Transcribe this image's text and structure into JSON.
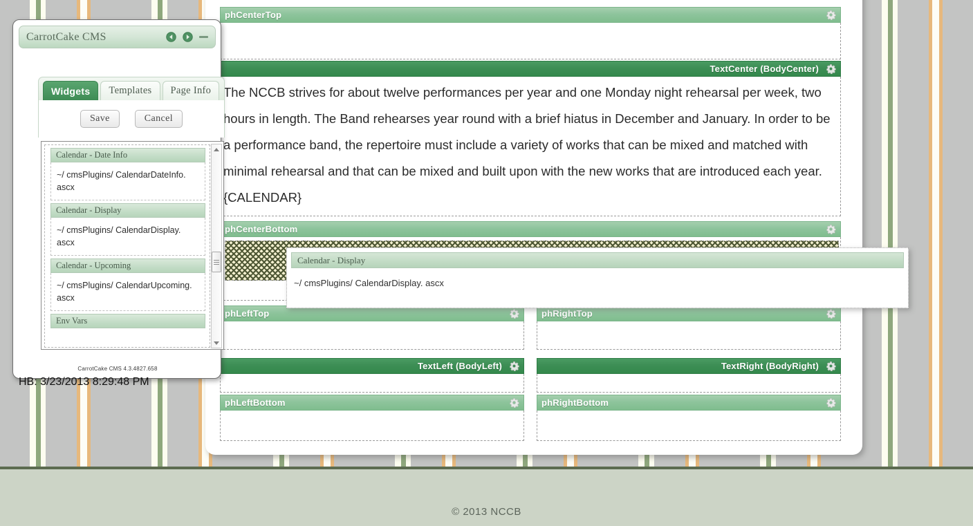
{
  "wallpaper": {
    "stripe_colors": [
      "#c3c4c3",
      "#fdfdf0",
      "#8fa87d",
      "#e7b87c"
    ],
    "baseline_color": "#5c6b50"
  },
  "footer": {
    "copyright": "© 2013 NCCB",
    "band_color": "#ccd4c6"
  },
  "cms_window": {
    "title": "CarrotCake CMS",
    "controls": {
      "prev_label": "◀",
      "next_label": "▶",
      "minimize_label": "—"
    },
    "tabs": [
      {
        "label": "Widgets",
        "active": true
      },
      {
        "label": "Templates",
        "active": false
      },
      {
        "label": "Page Info",
        "active": false
      }
    ],
    "buttons": {
      "save_label": "Save",
      "cancel_label": "Cancel"
    },
    "widgets": [
      {
        "name": "Calendar - Date Info",
        "path": "~/ cmsPlugins/ CalendarDateInfo. ascx"
      },
      {
        "name": "Calendar - Display",
        "path": "~/ cmsPlugins/ CalendarDisplay. ascx"
      },
      {
        "name": "Calendar - Upcoming",
        "path": "~/ cmsPlugins/ CalendarUpcoming. ascx"
      },
      {
        "name": "Env Vars",
        "path": ""
      }
    ],
    "version": "CarrotCake CMS 4.3.4827.658",
    "heartbeat": "HB: 3/23/2013 8:29:48 PM"
  },
  "drag_widget": {
    "name": "Calendar - Display",
    "path": "~/ cmsPlugins/ CalendarDisplay. ascx"
  },
  "page": {
    "zones": [
      {
        "id": "phCenterTop",
        "label": "phCenterTop",
        "dark": false
      },
      {
        "id": "textCenter",
        "label": "TextCenter (BodyCenter)",
        "dark": true
      },
      {
        "id": "phCenterBottom",
        "label": "phCenterBottom",
        "dark": false
      },
      {
        "id": "phLeftTop",
        "label": "phLeftTop",
        "dark": false
      },
      {
        "id": "phRightTop",
        "label": "phRightTop",
        "dark": false
      },
      {
        "id": "textLeft",
        "label": "TextLeft (BodyLeft)",
        "dark": true
      },
      {
        "id": "textRight",
        "label": "TextRight (BodyRight)",
        "dark": true
      },
      {
        "id": "phLeftBottom",
        "label": "phLeftBottom",
        "dark": false
      },
      {
        "id": "phRightBottom",
        "label": "phRightBottom",
        "dark": false
      }
    ],
    "body_center_paragraphs": [
      "The NCCB strives for about twelve performances per year and one Monday night rehearsal per week, two hours in length. The Band rehearses year round with a brief hiatus in December and January. In order to be a performance band, the repertoire must include a variety of works that can be mixed and matched with minimal rehearsal and that can be mixed and built upon with the new works that are introduced each year.",
      "{CALENDAR}"
    ],
    "gear_icon": "gear-icon"
  },
  "colors": {
    "zone_header_light": "#8ec49c",
    "zone_header_dark": "#3d8e55",
    "accent_green": "#4a9b62",
    "hatch_fill": "#f2efce",
    "hatch_line": "#4d5633"
  }
}
